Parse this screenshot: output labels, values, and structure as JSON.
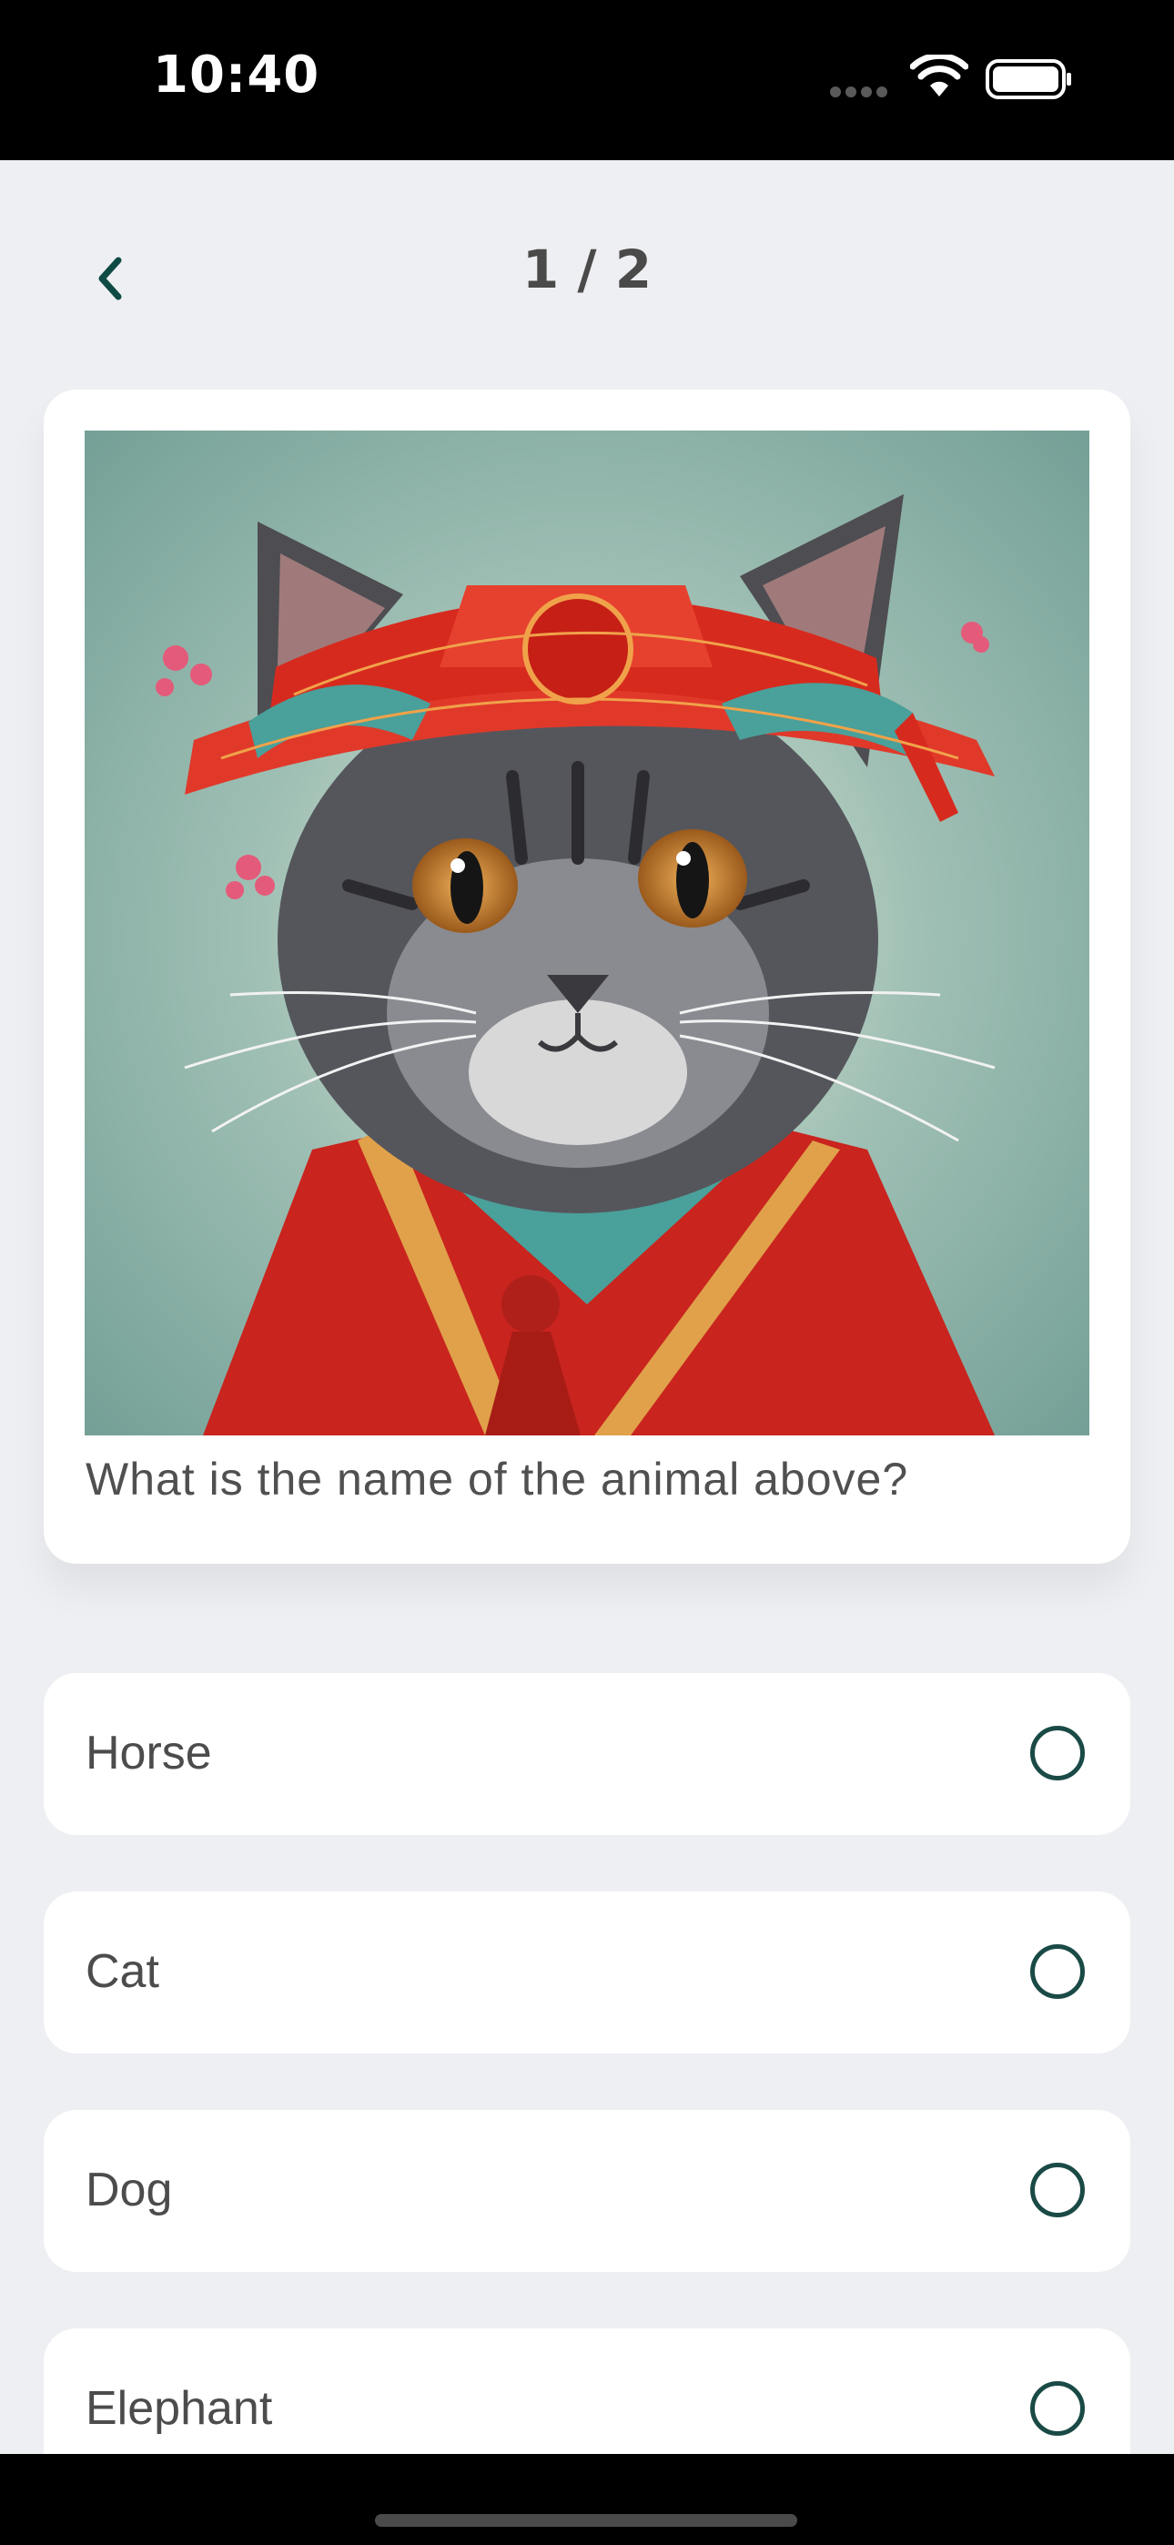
{
  "status_bar": {
    "time": "10:40"
  },
  "nav": {
    "progress": "1 / 2",
    "accent_color": "#0f4a44"
  },
  "question": {
    "text": "What is the name of the animal above?",
    "image_icon": "cat-in-red-costume-illustration"
  },
  "options": [
    {
      "label": "Horse",
      "selected": false
    },
    {
      "label": "Cat",
      "selected": false
    },
    {
      "label": "Dog",
      "selected": false
    },
    {
      "label": "Elephant",
      "selected": false
    }
  ]
}
